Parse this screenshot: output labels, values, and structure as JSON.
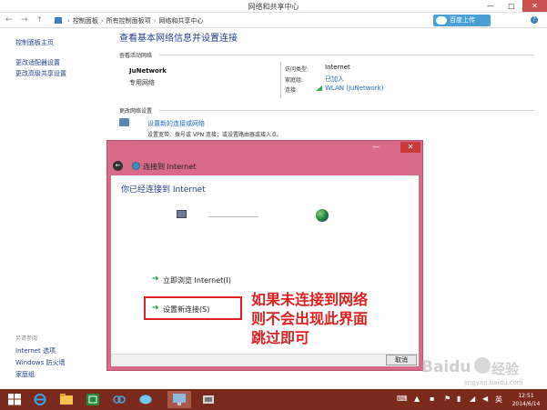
{
  "window": {
    "title": "网络和共享中心",
    "controls": {
      "minimize": "—",
      "maximize": "□",
      "close": "✕"
    }
  },
  "addressbar": {
    "back": "←",
    "forward": "→",
    "up": "↑",
    "breadcrumb": [
      "控制面板",
      "所有控制面板项",
      "网络和共享中心"
    ],
    "breadcrumb_sep": "›",
    "upload_button": "百度上传",
    "help": "?"
  },
  "leftpane": {
    "links": [
      "控制面板主页",
      "更改适配器设置",
      "更改高级共享设置"
    ],
    "see_also": "另请参阅",
    "see_also_links": [
      "Internet 选项",
      "Windows 防火墙",
      "家庭组"
    ]
  },
  "main": {
    "heading": "查看基本网络信息并设置连接",
    "active_label": "查看活动网络",
    "network": {
      "name": "JuNetwork",
      "type": "专用网络",
      "access_type_label": "访问类型:",
      "access_type_value": "Internet",
      "homegroup_label": "家庭组:",
      "homegroup_value": "已加入",
      "connection_label": "连接:",
      "connection_value": "WLAN (JuNetwork)"
    },
    "change_label": "更改网络设置",
    "setup_link": "设置新的连接或网络",
    "setup_desc": "设置宽带、拨号或 VPN 连接；或设置路由器或接入点。"
  },
  "dialog": {
    "title": "连接到 Internet",
    "minimize": "—",
    "close": "✕",
    "back": "←",
    "heading": "你已经连接到 Internet",
    "options": [
      {
        "label": "立即浏览 Internet(I)",
        "arrow": "➜"
      },
      {
        "label": "设置新连接(S)",
        "arrow": "➜"
      }
    ],
    "cancel": "取消"
  },
  "annotation": {
    "lines": [
      "如果未连接到网络",
      "则不会出现此界面",
      "跳过即可"
    ],
    "color": "#e02020"
  },
  "watermark": {
    "brand": "Baidu",
    "cn": "经验",
    "url": "jingyan.baidu.com"
  },
  "taskbar": {
    "ime": "英",
    "time": "12:51",
    "date": "2014/6/14"
  },
  "colors": {
    "link": "#1f3f8e",
    "dialog_frame": "#d86a8a",
    "taskbar": "#7a2b1e"
  }
}
